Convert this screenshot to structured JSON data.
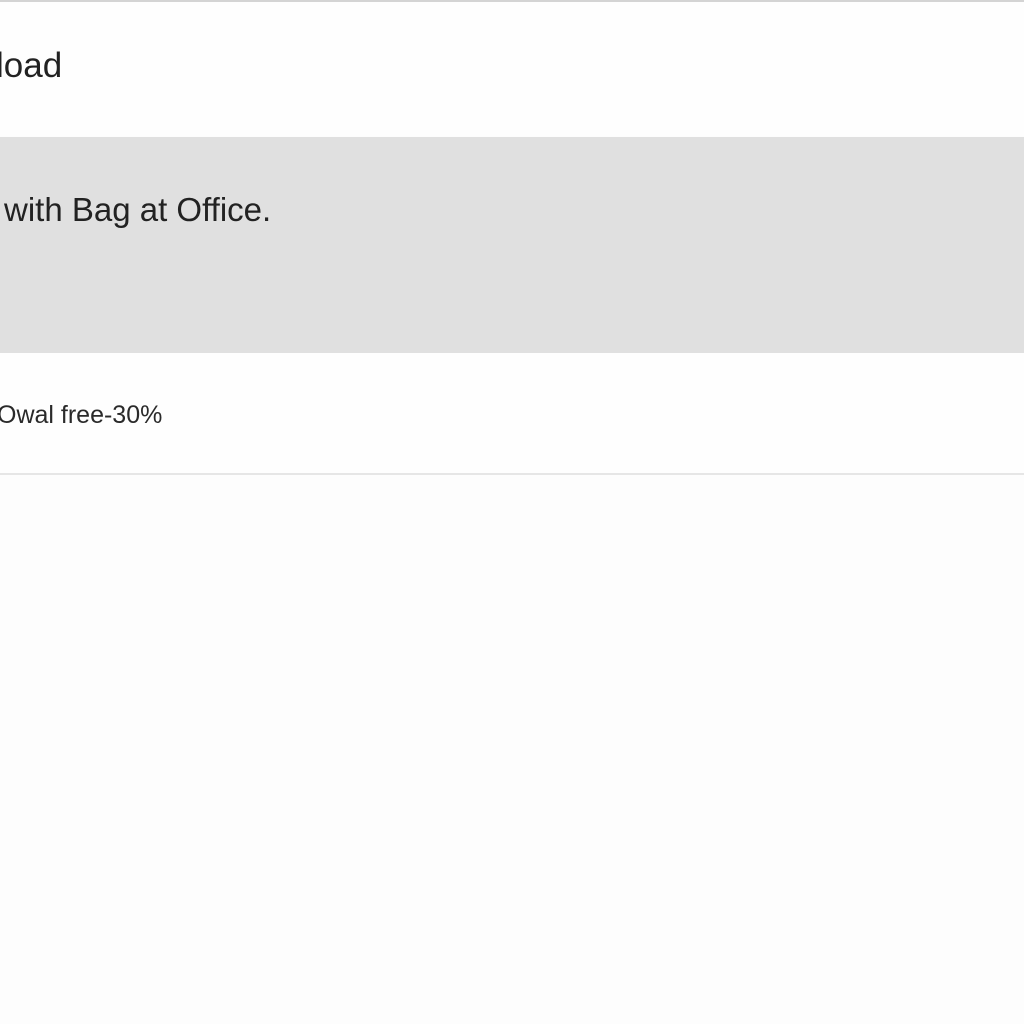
{
  "header": {
    "title": "load"
  },
  "selected_item": {
    "text": "with Bag at Office."
  },
  "list_item": {
    "text": "Owal free-30%"
  },
  "colors": {
    "selected_background": "#e0e0e0",
    "background": "#fdfdfd",
    "divider": "#e6e6e6"
  }
}
